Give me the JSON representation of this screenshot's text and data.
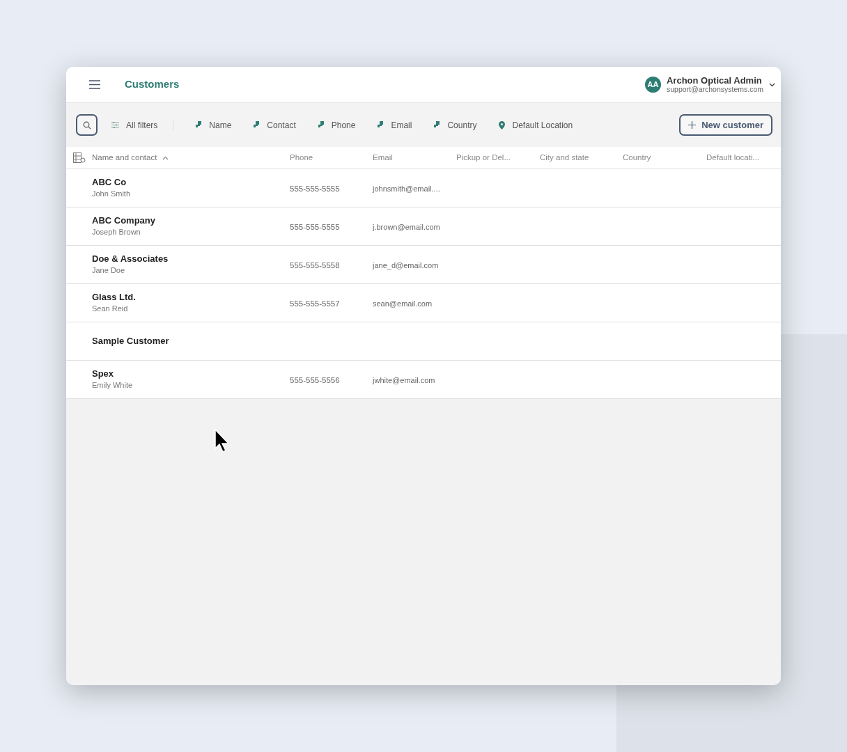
{
  "header": {
    "title": "Customers",
    "user": {
      "initials": "AA",
      "name": "Archon Optical Admin",
      "email": "support@archonsystems.com"
    }
  },
  "filters": [
    {
      "label": "All filters",
      "kind": "all"
    },
    {
      "label": "Name",
      "kind": "field"
    },
    {
      "label": "Contact",
      "kind": "field"
    },
    {
      "label": "Phone",
      "kind": "field"
    },
    {
      "label": "Email",
      "kind": "field"
    },
    {
      "label": "Country",
      "kind": "field"
    },
    {
      "label": "Default Location",
      "kind": "location"
    }
  ],
  "new_button": {
    "label": "New customer"
  },
  "table": {
    "columns": [
      {
        "label": "Name and contact",
        "sorted": true
      },
      {
        "label": "Phone",
        "sorted": false
      },
      {
        "label": "Email",
        "sorted": false
      },
      {
        "label": "Pickup or Del...",
        "sorted": false
      },
      {
        "label": "City and state",
        "sorted": false
      },
      {
        "label": "Country",
        "sorted": false
      },
      {
        "label": "Default locati...",
        "sorted": false
      }
    ],
    "rows": [
      {
        "name": "ABC Co",
        "contact": "John Smith",
        "phone": "555-555-5555",
        "email": "johnsmith@email...."
      },
      {
        "name": "ABC Company",
        "contact": "Joseph Brown",
        "phone": "555-555-5555",
        "email": "j.brown@email.com"
      },
      {
        "name": "Doe & Associates",
        "contact": "Jane Doe",
        "phone": "555-555-5558",
        "email": "jane_d@email.com"
      },
      {
        "name": "Glass Ltd.",
        "contact": "Sean Reid",
        "phone": "555-555-5557",
        "email": "sean@email.com"
      },
      {
        "name": "Sample Customer"
      },
      {
        "name": "Spex",
        "contact": "Emily White",
        "phone": "555-555-5556",
        "email": "jwhite@email.com"
      }
    ]
  }
}
